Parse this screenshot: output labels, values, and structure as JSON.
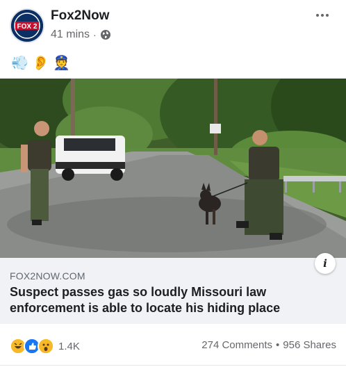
{
  "header": {
    "page_name": "Fox2Now",
    "time": "41 mins",
    "separator": "·",
    "avatar_text": "FOX 2",
    "avatar_color": "#0b2f63"
  },
  "emoji_row": [
    "💨",
    "👂",
    "👮"
  ],
  "link": {
    "domain": "FOX2NOW.COM",
    "title": "Suspect passes gas so loudly Missouri law enforcement is able to locate his hiding place",
    "info_label": "i"
  },
  "footer": {
    "reaction_count": "1.4K",
    "reactions": [
      "haha",
      "like",
      "wow"
    ],
    "comments": "274 Comments",
    "separator": "•",
    "shares": "956 Shares"
  }
}
